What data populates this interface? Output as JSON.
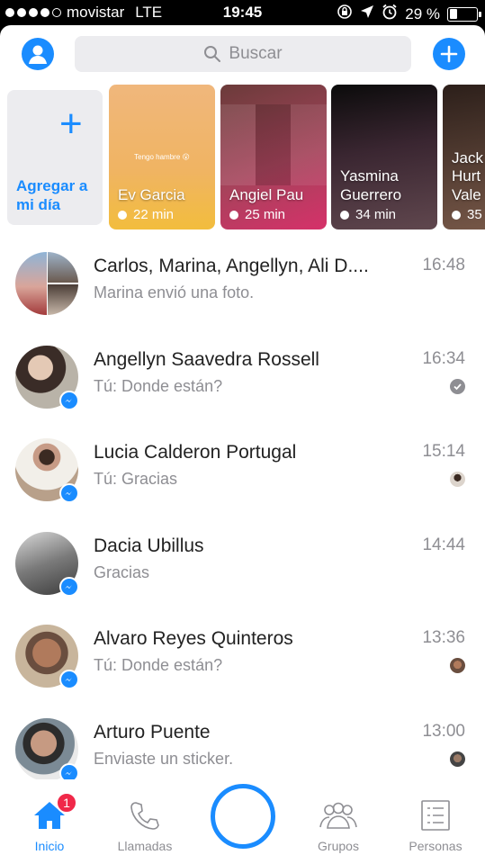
{
  "status": {
    "carrier": "movistar",
    "network": "LTE",
    "time": "19:45",
    "battery": "29 %",
    "battery_level": 0.29
  },
  "header": {
    "search_placeholder": "Buscar"
  },
  "stories": {
    "add_label_line1": "Agregar a",
    "add_label_line2": "mi día",
    "items": [
      {
        "name": "Ev Garcia",
        "time": "22 min",
        "caption": "Tengo hambre 😮"
      },
      {
        "name": "Angiel Pau",
        "time": "25 min"
      },
      {
        "name_line1": "Yasmina",
        "name_line2": "Guerrero",
        "time": "34 min"
      },
      {
        "name_line1": "Jack",
        "name_line2": "Hurt",
        "name_line3": "Vale",
        "time": "35"
      }
    ]
  },
  "chats": [
    {
      "name": "Carlos, Marina, Angellyn, Ali D....",
      "preview": "Marina envió una foto.",
      "time": "16:48"
    },
    {
      "name": "Angellyn Saavedra Rossell",
      "preview": "Tú: Donde están?",
      "time": "16:34"
    },
    {
      "name": "Lucia Calderon Portugal",
      "preview": "Tú: Gracias",
      "time": "15:14"
    },
    {
      "name": "Dacia Ubillus",
      "preview": "Gracias",
      "time": "14:44"
    },
    {
      "name": "Alvaro Reyes Quinteros",
      "preview": "Tú: Donde están?",
      "time": "13:36"
    },
    {
      "name": "Arturo Puente",
      "preview": "Enviaste un sticker.",
      "time": "13:00"
    }
  ],
  "tabs": {
    "home": "Inicio",
    "home_badge": "1",
    "calls": "Llamadas",
    "groups": "Grupos",
    "people": "Personas"
  },
  "colors": {
    "accent": "#1a8cff",
    "badge": "#f02849"
  }
}
